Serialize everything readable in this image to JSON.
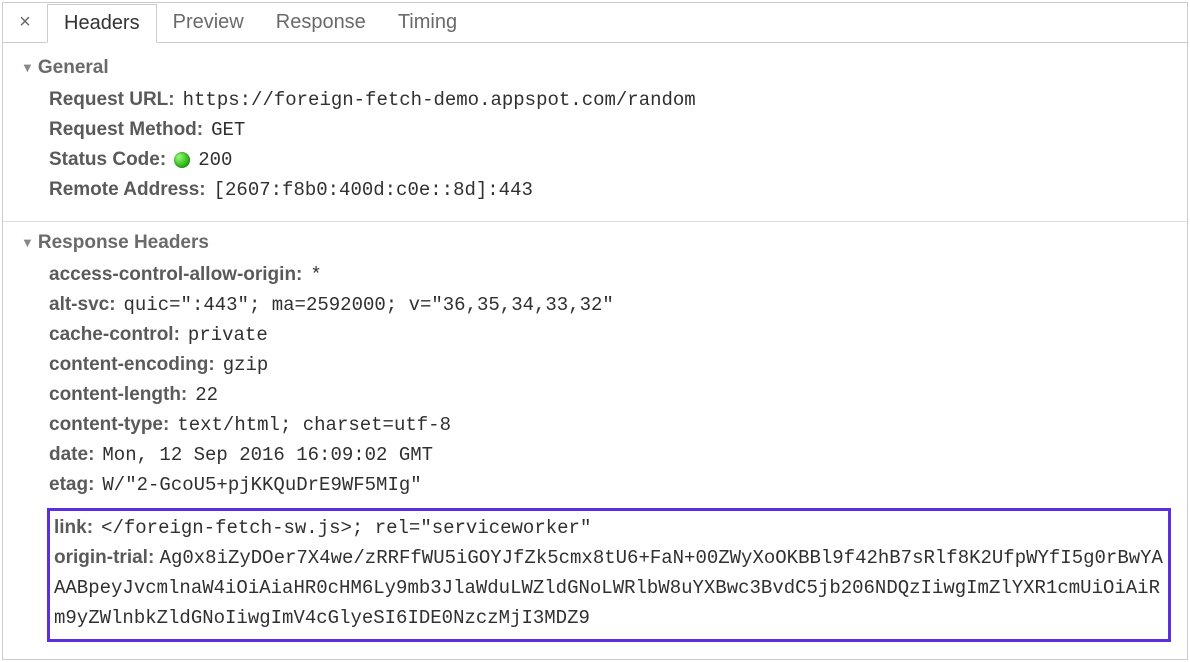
{
  "tabs": {
    "headers": "Headers",
    "preview": "Preview",
    "response": "Response",
    "timing": "Timing"
  },
  "sections": {
    "general": {
      "title": "General",
      "request_url_label": "Request URL:",
      "request_url_value": "https://foreign-fetch-demo.appspot.com/random",
      "request_method_label": "Request Method:",
      "request_method_value": "GET",
      "status_code_label": "Status Code:",
      "status_code_value": "200",
      "remote_address_label": "Remote Address:",
      "remote_address_value": "[2607:f8b0:400d:c0e::8d]:443"
    },
    "response_headers": {
      "title": "Response Headers",
      "items": {
        "acao_label": "access-control-allow-origin:",
        "acao_value": "*",
        "altsvc_label": "alt-svc:",
        "altsvc_value": "quic=\":443\"; ma=2592000; v=\"36,35,34,33,32\"",
        "cache_label": "cache-control:",
        "cache_value": "private",
        "cenc_label": "content-encoding:",
        "cenc_value": "gzip",
        "clen_label": "content-length:",
        "clen_value": "22",
        "ctype_label": "content-type:",
        "ctype_value": "text/html; charset=utf-8",
        "date_label": "date:",
        "date_value": "Mon, 12 Sep 2016 16:09:02 GMT",
        "etag_label": "etag:",
        "etag_value": "W/\"2-GcoU5+pjKKQuDrE9WF5MIg\"",
        "link_label": "link:",
        "link_value": "</foreign-fetch-sw.js>; rel=\"serviceworker\"",
        "ot_label": "origin-trial:",
        "ot_value": "Ag0x8iZyDOer7X4we/zRRFfWU5iGOYJfZk5cmx8tU6+FaN+00ZWyXoOKBBl9f42hB7sRlf8K2UfpWYfI5g0rBwYAAABpeyJvcmlnaW4iOiAiaHR0cHM6Ly9mb3JlaWduLWZldGNoLWRlbW8uYXBwc3BvdC5jb206NDQzIiwgImZlYXR1cmUiOiAiRm9yZWlnbkZldGNoIiwgImV4cGlyeSI6IDE0NzczMjI3MDZ9"
      }
    }
  }
}
